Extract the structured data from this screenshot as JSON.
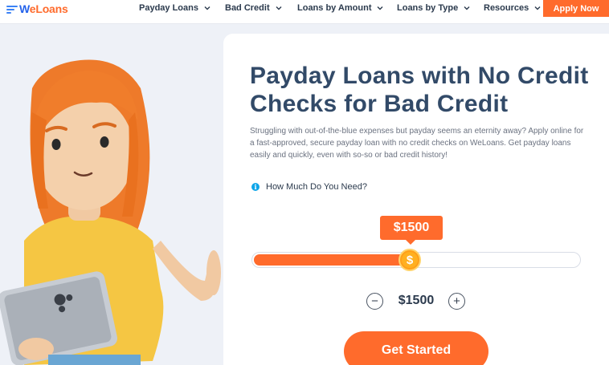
{
  "header": {
    "logo_text_w": "W",
    "logo_text_rest": "eLoans",
    "nav": [
      {
        "label": "Payday Loans"
      },
      {
        "label": "Bad Credit"
      },
      {
        "label": "Loans by Amount"
      },
      {
        "label": "Loans by Type"
      },
      {
        "label": "Resources"
      }
    ],
    "apply_label": "Apply Now"
  },
  "main": {
    "title": "Payday Loans with No Credit Checks for Bad Credit",
    "description": "Struggling with out-of-the-blue expenses but payday seems an eternity away? Apply online for a fast-approved, secure payday loan with no credit checks on WeLoans. Get payday loans easily and quickly, even with so-so or bad credit history!",
    "question": "How Much Do You Need?",
    "info_icon": "i",
    "slider": {
      "bubble_value": "$1500",
      "fill_fraction": 0.48,
      "thumb_glyph": "$"
    },
    "stepper": {
      "minus_glyph": "−",
      "value": "$1500",
      "plus_glyph": "+"
    },
    "cta_label": "Get Started"
  },
  "colors": {
    "brand_orange": "#ff6b2c",
    "brand_blue": "#2563eb",
    "title_navy": "#324a68",
    "info_blue": "#0ea5e9"
  },
  "icons": {
    "logo": "weloans-logo-icon",
    "nav_chevron": "chevron-down-icon",
    "info": "info-icon",
    "thumb": "dollar-coin-icon",
    "illustration": "woman-with-tablet-illustration"
  }
}
